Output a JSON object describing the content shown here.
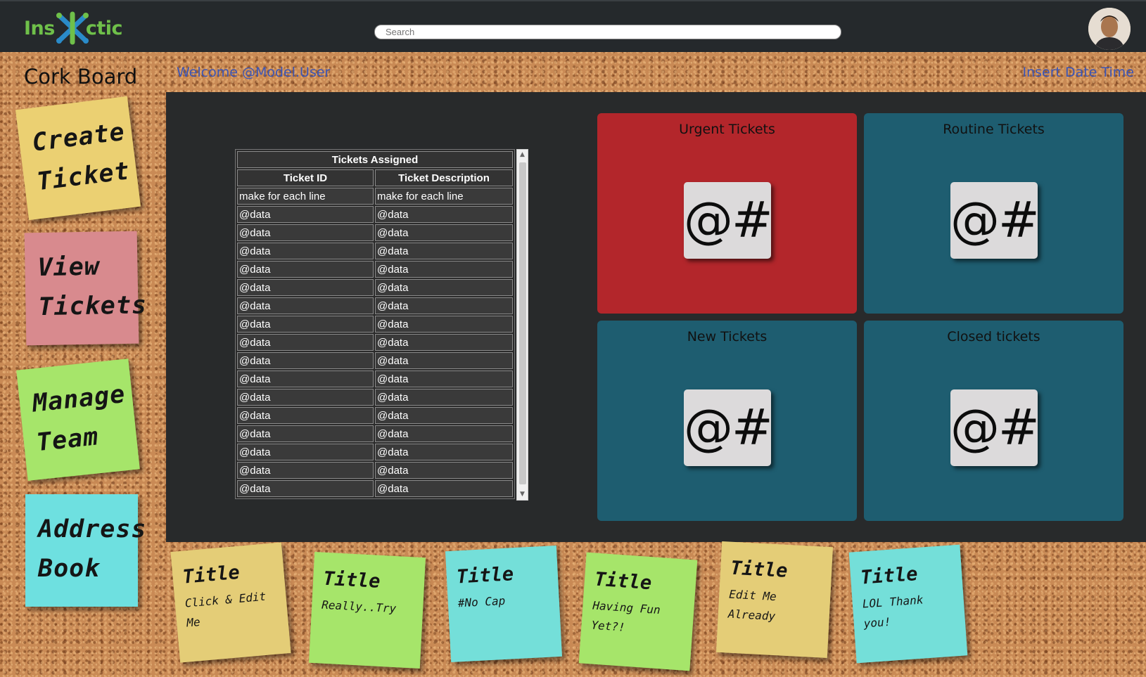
{
  "header": {
    "logo_left": "Ins",
    "logo_right": "ctic",
    "search_placeholder": "Search"
  },
  "page": {
    "title": "Cork Board",
    "welcome": "Welcome @Model.User",
    "datetime": "Insert Date Time"
  },
  "sidebar": {
    "create": [
      "Create",
      "Ticket"
    ],
    "view": [
      "View",
      "Tickets"
    ],
    "manage": [
      "Manage",
      "Team"
    ],
    "address": [
      "Address",
      "Book"
    ]
  },
  "table": {
    "title": "Tickets Assigned",
    "columns": [
      "Ticket ID",
      "Ticket Description"
    ],
    "first_row": [
      "make for each line",
      "make for each line"
    ],
    "rows": [
      [
        "@data",
        "@data"
      ],
      [
        "@data",
        "@data"
      ],
      [
        "@data",
        "@data"
      ],
      [
        "@data",
        "@data"
      ],
      [
        "@data",
        "@data"
      ],
      [
        "@data",
        "@data"
      ],
      [
        "@data",
        "@data"
      ],
      [
        "@data",
        "@data"
      ],
      [
        "@data",
        "@data"
      ],
      [
        "@data",
        "@data"
      ],
      [
        "@data",
        "@data"
      ],
      [
        "@data",
        "@data"
      ],
      [
        "@data",
        "@data"
      ],
      [
        "@data",
        "@data"
      ],
      [
        "@data",
        "@data"
      ],
      [
        "@data",
        "@data"
      ]
    ]
  },
  "tiles": {
    "urgent": {
      "label": "Urgent Tickets",
      "value": "@#"
    },
    "routine": {
      "label": "Routine Tickets",
      "value": "@#"
    },
    "new": {
      "label": "New Tickets",
      "value": "@#"
    },
    "closed": {
      "label": "Closed tickets",
      "value": "@#"
    }
  },
  "notes": [
    {
      "title": "Title",
      "body": "Click & Edit Me"
    },
    {
      "title": "Title",
      "body": "Really..Try"
    },
    {
      "title": "Title",
      "body": "#No Cap"
    },
    {
      "title": "Title",
      "body": "Having Fun Yet?!"
    },
    {
      "title": "Title",
      "body": "Edit Me Already"
    },
    {
      "title": "Title",
      "body": "LOL Thank you!"
    }
  ],
  "colors": {
    "topbar": "#25292c",
    "urgent": "#b3262b",
    "tile": "#1e5d70",
    "link": "#3b55b5"
  }
}
